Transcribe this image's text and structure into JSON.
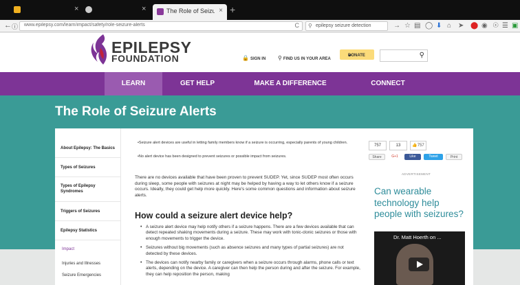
{
  "browser": {
    "tab_title": "The Role of Seizure Alerts ...",
    "tab_close": "×",
    "new_tab": "+",
    "url": "www.epilepsy.com/learn/impact/safety/role-seizure-alerts",
    "reload": "C",
    "search_placeholder": "epilepsy seizure detection"
  },
  "header": {
    "logo_line1": "EPILEPSY",
    "logo_line2": "FOUNDATION",
    "sign_in": "SIGN IN",
    "find_us": "FIND US IN YOUR AREA",
    "donate": "DONATE"
  },
  "nav": [
    {
      "label": "LEARN"
    },
    {
      "label": "GET HELP"
    },
    {
      "label": "MAKE A DIFFERENCE"
    },
    {
      "label": "CONNECT"
    }
  ],
  "page_title": "The Role of Seizure Alerts",
  "sidebar": {
    "items": [
      {
        "label": "About Epilepsy: The Basics"
      },
      {
        "label": "Types of Seizures"
      },
      {
        "label": "Types of Epilepsy Syndromes"
      },
      {
        "label": "Triggers of Seizures"
      },
      {
        "label": "Epilepsy Statistics"
      }
    ],
    "active": "Impact",
    "subitems": [
      {
        "label": "Injuries and Illnesses"
      },
      {
        "label": "Seizure Emergencies"
      }
    ]
  },
  "content": {
    "top_bullets": [
      "•Seizure alert devices are useful in letting family members know if a seizure is occurring, especially parents of young children.",
      "•No alert device has been designed to prevent seizures or possible impact from seizures."
    ],
    "paragraph": "There are no devices available that have been proven to prevent SUDEP. Yet, since SUDEP most often occurs during sleep, some people with seizures at night may be helped by having a way to let others know if a seizure occurs. Ideally, they could get help more quickly. Here's some common questions and information about seizure alerts.",
    "heading": "How could a seizure alert device help?",
    "bullets": [
      "A seizure alert device may help notify others if a seizure happens. There are a few devices available that can detect repeated shaking movements during a seizure. These may work with tonic-clonic seizures or those with enough movements to trigger the device.",
      "Seizures without big movements (such as absence seizures and many types of partial seizures) are not detected by these devices.",
      "The devices can notify nearby family or caregivers when a seizure occurs through alarms, phone calls or text alerts, depending on the device. A caregiver can then help the person during and after the seizure. For example, they can help reposition the person, making"
    ]
  },
  "share": {
    "count1": "757",
    "count2": "13",
    "like": "757",
    "share_label": "Share",
    "gplus": "G+1",
    "fb_like": "Like",
    "tweet": "Tweet",
    "print": "Print"
  },
  "ad_label": "ADVERTISEMENT",
  "promo": "Can wearable technology help people with seizures?",
  "video_title": "Dr. Matt Hoerth on ..."
}
